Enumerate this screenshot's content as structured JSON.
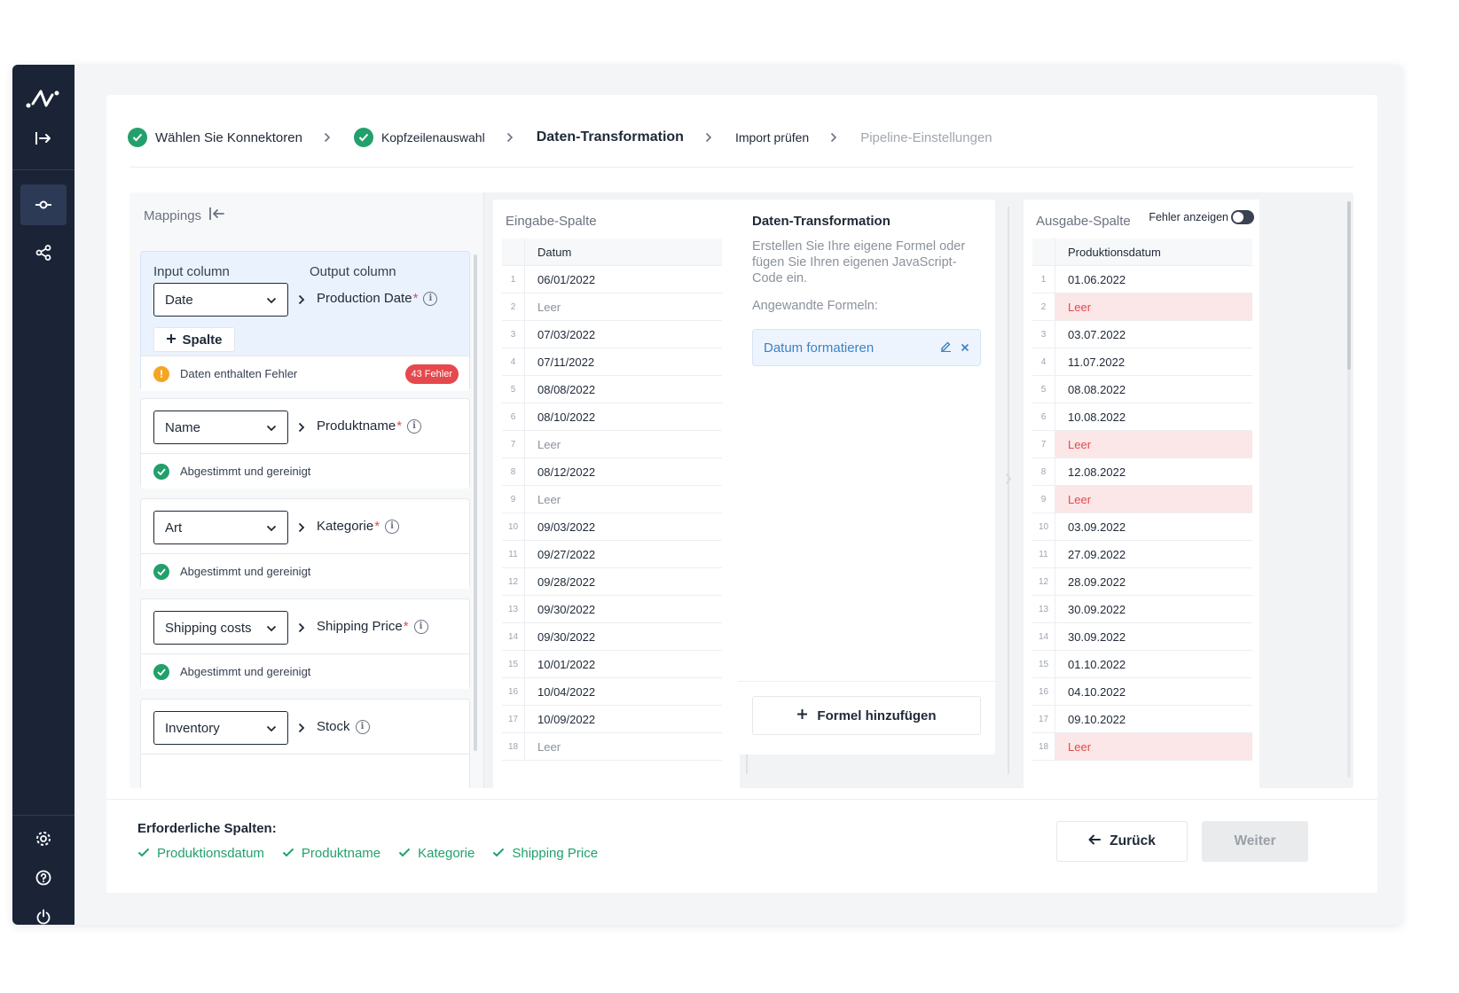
{
  "stepper": {
    "steps": [
      {
        "label": "Wählen Sie Konnektoren",
        "state": "done"
      },
      {
        "label": "Kopfzeilenauswahl",
        "state": "done"
      },
      {
        "label": "Daten-Transformation",
        "state": "active"
      },
      {
        "label": "Import prüfen",
        "state": "pending"
      },
      {
        "label": "Pipeline-Einstellungen",
        "state": "disabled"
      }
    ]
  },
  "mappings": {
    "title": "Mappings",
    "input_head": "Input column",
    "output_head": "Output column",
    "add_column_label": "Spalte",
    "items": [
      {
        "input": "Date",
        "output": "Production Date",
        "required": "*",
        "status": "Daten enthalten Fehler",
        "error_badge": "43 Fehler"
      },
      {
        "input": "Name",
        "output": "Produktname",
        "required": "*",
        "status": "Abgestimmt und gereinigt"
      },
      {
        "input": "Art",
        "output": "Kategorie",
        "required": "*",
        "status": "Abgestimmt und gereinigt"
      },
      {
        "input": "Shipping costs",
        "output": "Shipping Price",
        "required": "*",
        "status": "Abgestimmt und gereinigt"
      },
      {
        "input": "Inventory",
        "output": "Stock",
        "required": ""
      }
    ]
  },
  "input_column": {
    "title": "Eingabe-Spalte",
    "header": "Datum",
    "rows": [
      "06/01/2022",
      "Leer",
      "07/03/2022",
      "07/11/2022",
      "08/08/2022",
      "08/10/2022",
      "Leer",
      "08/12/2022",
      "Leer",
      "09/03/2022",
      "09/27/2022",
      "09/28/2022",
      "09/30/2022",
      "09/30/2022",
      "10/01/2022",
      "10/04/2022",
      "10/09/2022",
      "Leer"
    ]
  },
  "transformation": {
    "title": "Daten-Transformation",
    "description": "Erstellen Sie Ihre eigene Formel oder fügen Sie Ihren eigenen JavaScript-Code ein.",
    "applied_label": "Angewandte Formeln:",
    "formula": "Datum formatieren",
    "add_formula_label": "Formel hinzufügen"
  },
  "output_column": {
    "title": "Ausgabe-Spalte",
    "toggle_label": "Fehler anzeigen",
    "header": "Produktionsdatum",
    "rows": [
      "01.06.2022",
      "Leer",
      "03.07.2022",
      "11.07.2022",
      "08.08.2022",
      "10.08.2022",
      "Leer",
      "12.08.2022",
      "Leer",
      "03.09.2022",
      "27.09.2022",
      "28.09.2022",
      "30.09.2022",
      "30.09.2022",
      "01.10.2022",
      "04.10.2022",
      "09.10.2022",
      "Leer"
    ]
  },
  "footer": {
    "required_title": "Erforderliche Spalten:",
    "required": [
      "Produktionsdatum",
      "Produktname",
      "Kategorie",
      "Shipping Price"
    ],
    "back_label": "Zurück",
    "next_label": "Weiter"
  },
  "colors": {
    "sidebar": "#1b2437",
    "success": "#22a06b",
    "error": "#e5484d",
    "accent": "#3b82c4"
  }
}
